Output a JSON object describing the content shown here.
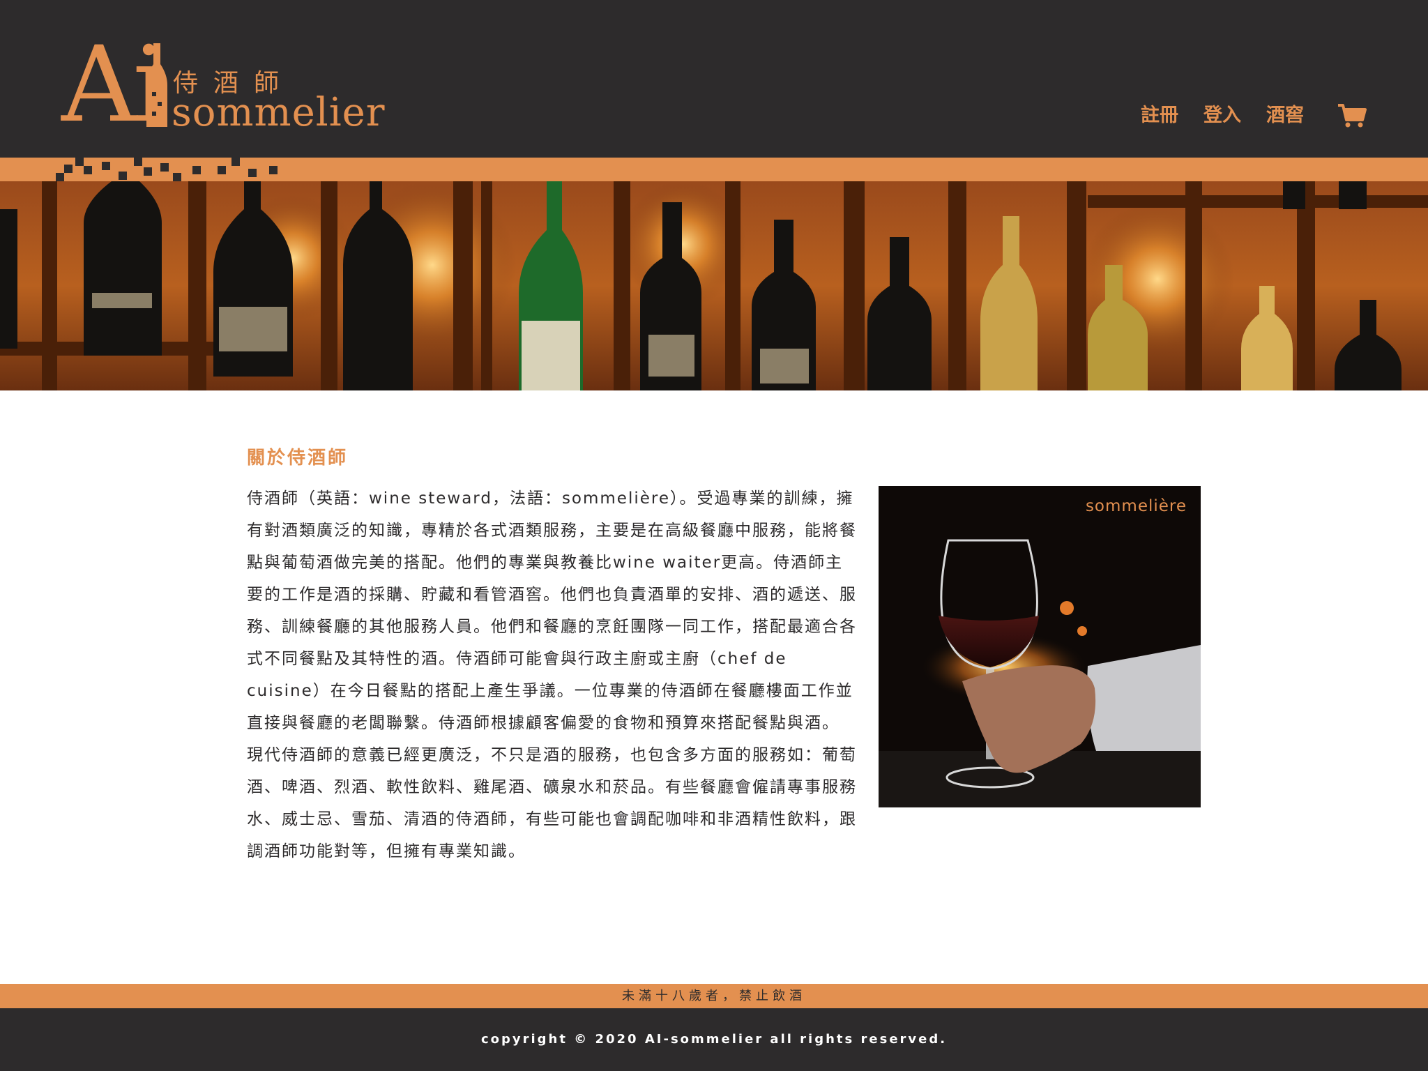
{
  "brand": {
    "logo_letters": "Ai",
    "logo_cn": "侍酒師",
    "logo_en": "sommelier"
  },
  "nav": {
    "items": [
      {
        "label": "註冊"
      },
      {
        "label": "登入"
      },
      {
        "label": "酒窖"
      }
    ],
    "cart_icon": "cart-icon"
  },
  "colors": {
    "accent": "#e39050",
    "dark": "#2d2b2c",
    "background": "#ffffff"
  },
  "about": {
    "title": "關於侍酒師",
    "paragraphs": [
      "侍酒師（英語：wine steward，法語：sommelière）。受過專業的訓練，擁有對酒類廣泛的知識，專精於各式酒類服務，主要是在高級餐廳中服務，能將餐點與葡萄酒做完美的搭配。他們的專業與教養比wine waiter更高。侍酒師主要的工作是酒的採購、貯藏和看管酒窖。他們也負責酒單的安排、酒的遞送、服務、訓練餐廳的其他服務人員。他們和餐廳的烹飪團隊一同工作，搭配最適合各式不同餐點及其特性的酒。侍酒師可能會與行政主廚或主廚（chef de cuisine）在今日餐點的搭配上產生爭議。一位專業的侍酒師在餐廳樓面工作並直接與餐廳的老闆聯繫。侍酒師根據顧客偏愛的食物和預算來搭配餐點與酒。",
      "現代侍酒師的意義已經更廣泛，不只是酒的服務，也包含多方面的服務如：葡萄酒、啤酒、烈酒、軟性飲料、雞尾酒、礦泉水和菸品。有些餐廳會僱請專事服務水、威士忌、雪茄、清酒的侍酒師，有些可能也會調配咖啡和非酒精性飲料，跟調酒師功能對等，但擁有專業知識。"
    ],
    "photo_caption": "sommelière"
  },
  "footer": {
    "warning": "未滿十八歲者，禁止飲酒",
    "copyright": "copyright © 2020 AI-sommelier all rights reserved."
  }
}
